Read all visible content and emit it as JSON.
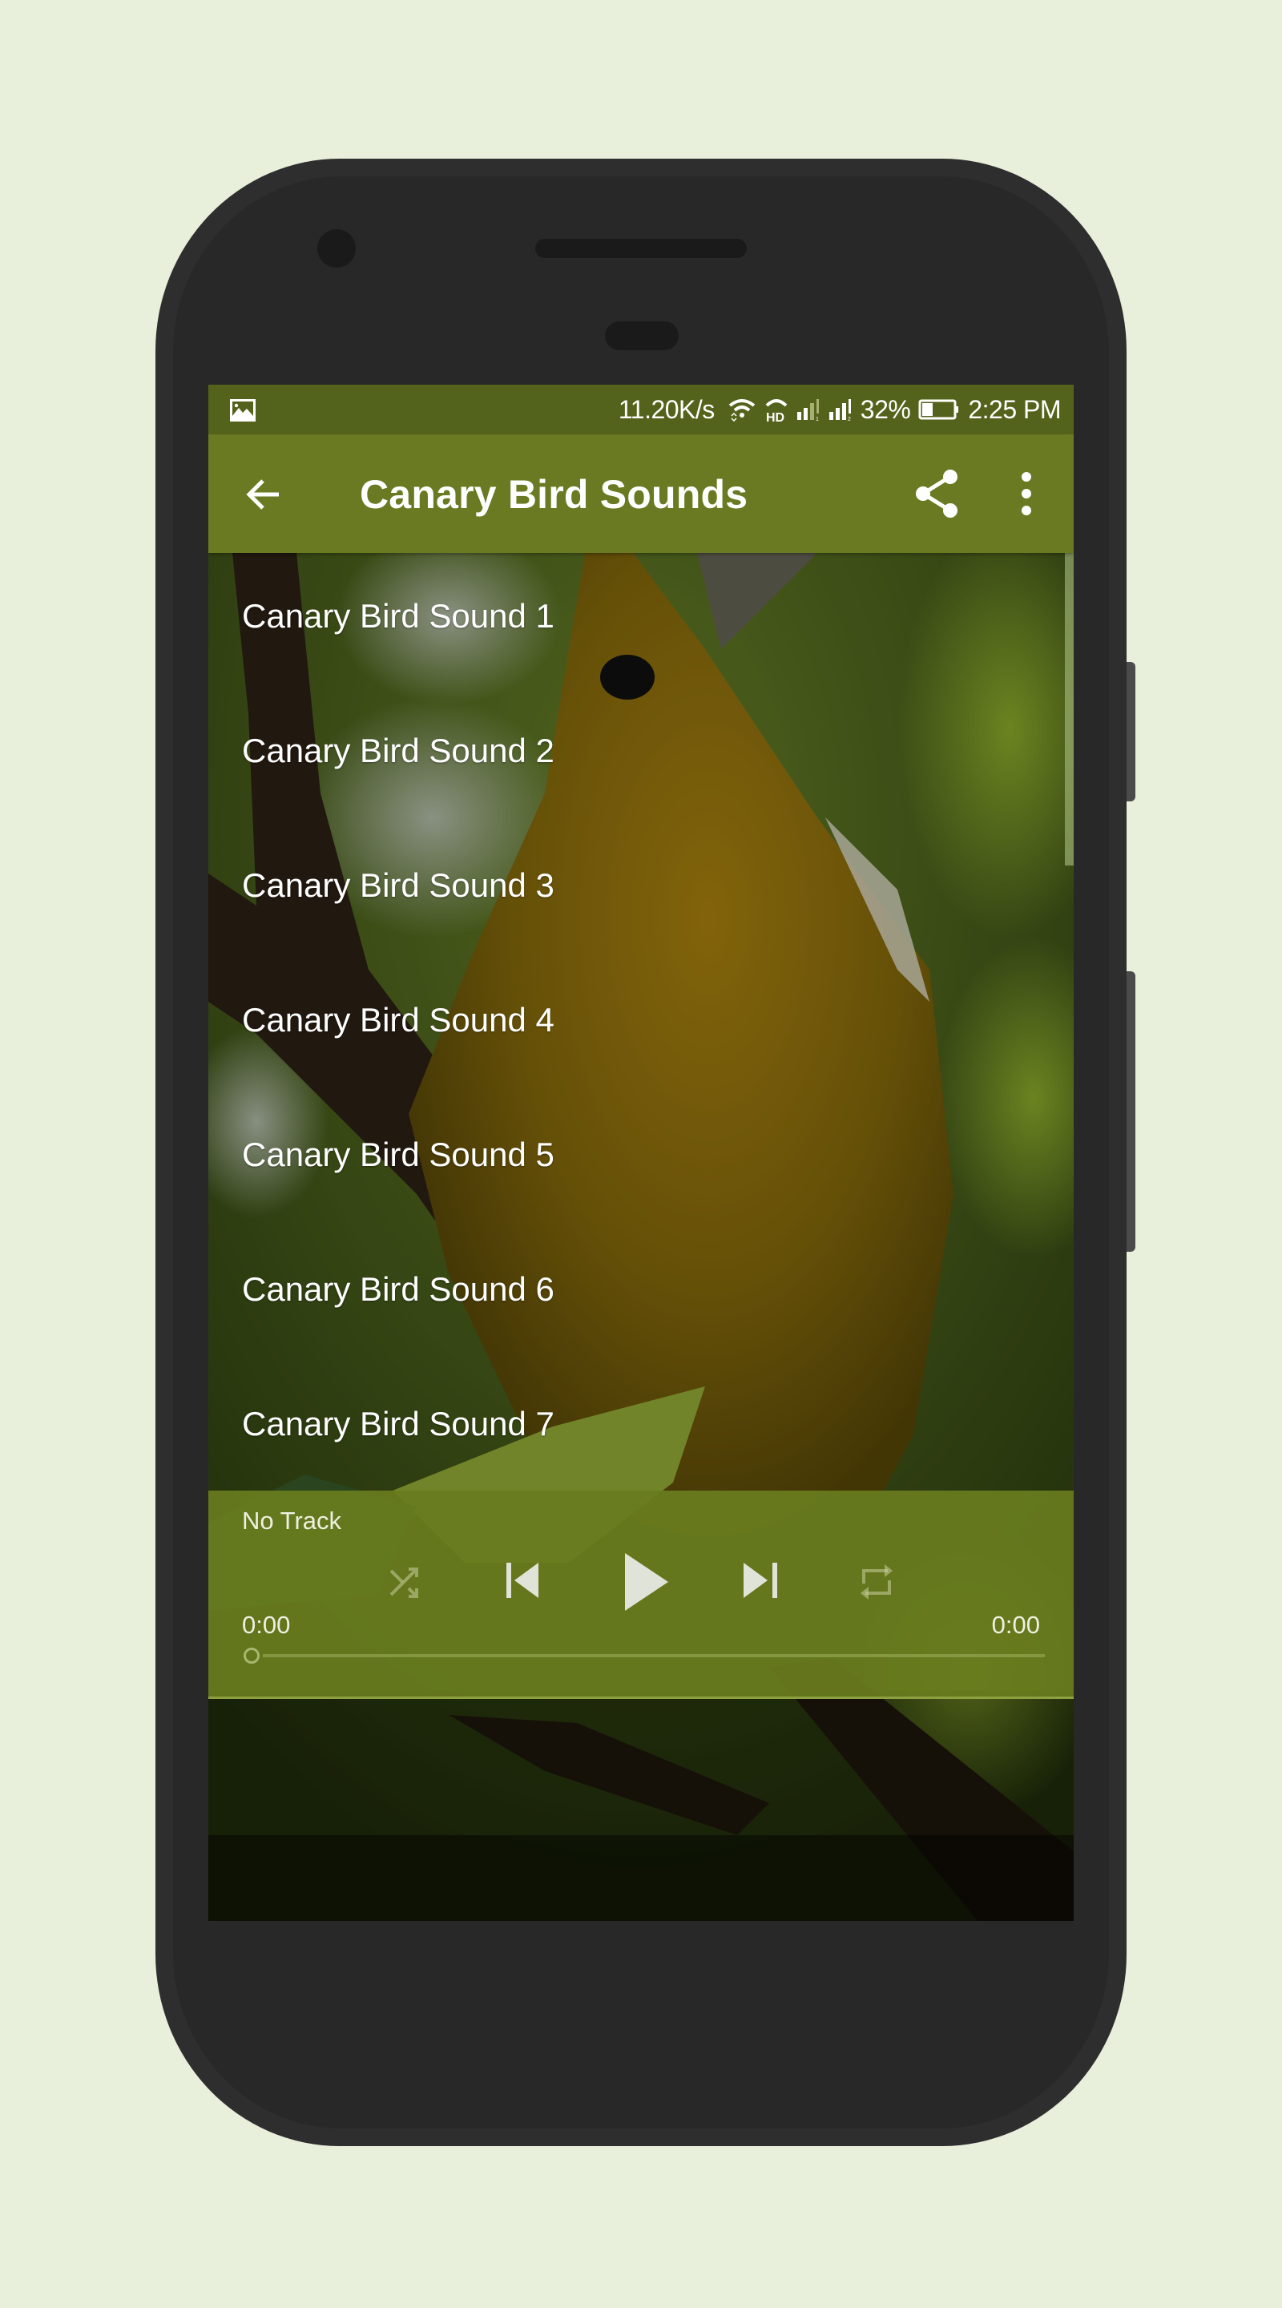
{
  "status_bar": {
    "notification_icon": "image-icon",
    "network_speed": "11.20K/s",
    "wifi_icon": "wifi-icon",
    "hd_call_icon": "hd-voice-icon",
    "signal_sim1_icon": "signal-sim1-icon",
    "signal_sim2_icon": "signal-sim2-icon",
    "battery_percent": "32%",
    "battery_icon": "battery-icon",
    "time": "2:25 PM"
  },
  "toolbar": {
    "back_icon": "arrow-back-icon",
    "title": "Canary Bird Sounds",
    "share_icon": "share-icon",
    "more_icon": "more-vert-icon"
  },
  "tracks": [
    {
      "label": "Canary Bird Sound 1"
    },
    {
      "label": "Canary Bird Sound 2"
    },
    {
      "label": "Canary Bird Sound 3"
    },
    {
      "label": "Canary Bird Sound 4"
    },
    {
      "label": "Canary Bird Sound 5"
    },
    {
      "label": "Canary Bird Sound 6"
    },
    {
      "label": "Canary Bird Sound 7"
    }
  ],
  "player": {
    "track_name": "No Track",
    "elapsed": "0:00",
    "duration": "0:00",
    "progress": 0,
    "controls": [
      "shuffle-icon",
      "skip-previous-icon",
      "play-icon",
      "skip-next-icon",
      "repeat-icon"
    ]
  },
  "colors": {
    "primary": "#6a7a22",
    "primary_dark": "#54631b",
    "page_background": "#e8efdb",
    "device_body": "#2d2e2d"
  }
}
